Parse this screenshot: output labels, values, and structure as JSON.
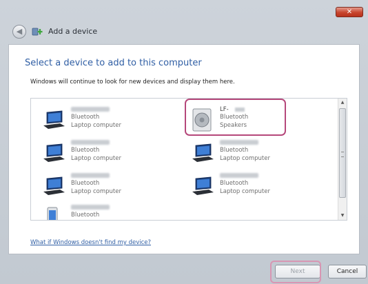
{
  "window": {
    "title": "Add a device",
    "close_glyph": "✕"
  },
  "header": {
    "heading": "Select a device to add to this computer",
    "subtext": "Windows will continue to look for new devices and display them here."
  },
  "devices": [
    {
      "line1": "Bluetooth",
      "line2": "Laptop computer",
      "icon": "laptop-icon"
    },
    {
      "name_prefix": "LF-",
      "line1": "Bluetooth",
      "line2": "Speakers",
      "icon": "speaker-icon"
    },
    {
      "line1": "Bluetooth",
      "line2": "Laptop computer",
      "icon": "laptop-icon"
    },
    {
      "line1": "Bluetooth",
      "line2": "Laptop computer",
      "icon": "laptop-icon"
    },
    {
      "line1": "Bluetooth",
      "line2": "Laptop computer",
      "icon": "laptop-icon"
    },
    {
      "line1": "Bluetooth",
      "line2": "Laptop computer",
      "icon": "laptop-icon"
    },
    {
      "line1": "Bluetooth",
      "icon": "phone-icon"
    }
  ],
  "help_link": "What if Windows doesn't find my device?",
  "buttons": {
    "next": "Next",
    "cancel": "Cancel"
  },
  "colors": {
    "heading": "#2f5ea4",
    "highlight": "#b5477a"
  }
}
